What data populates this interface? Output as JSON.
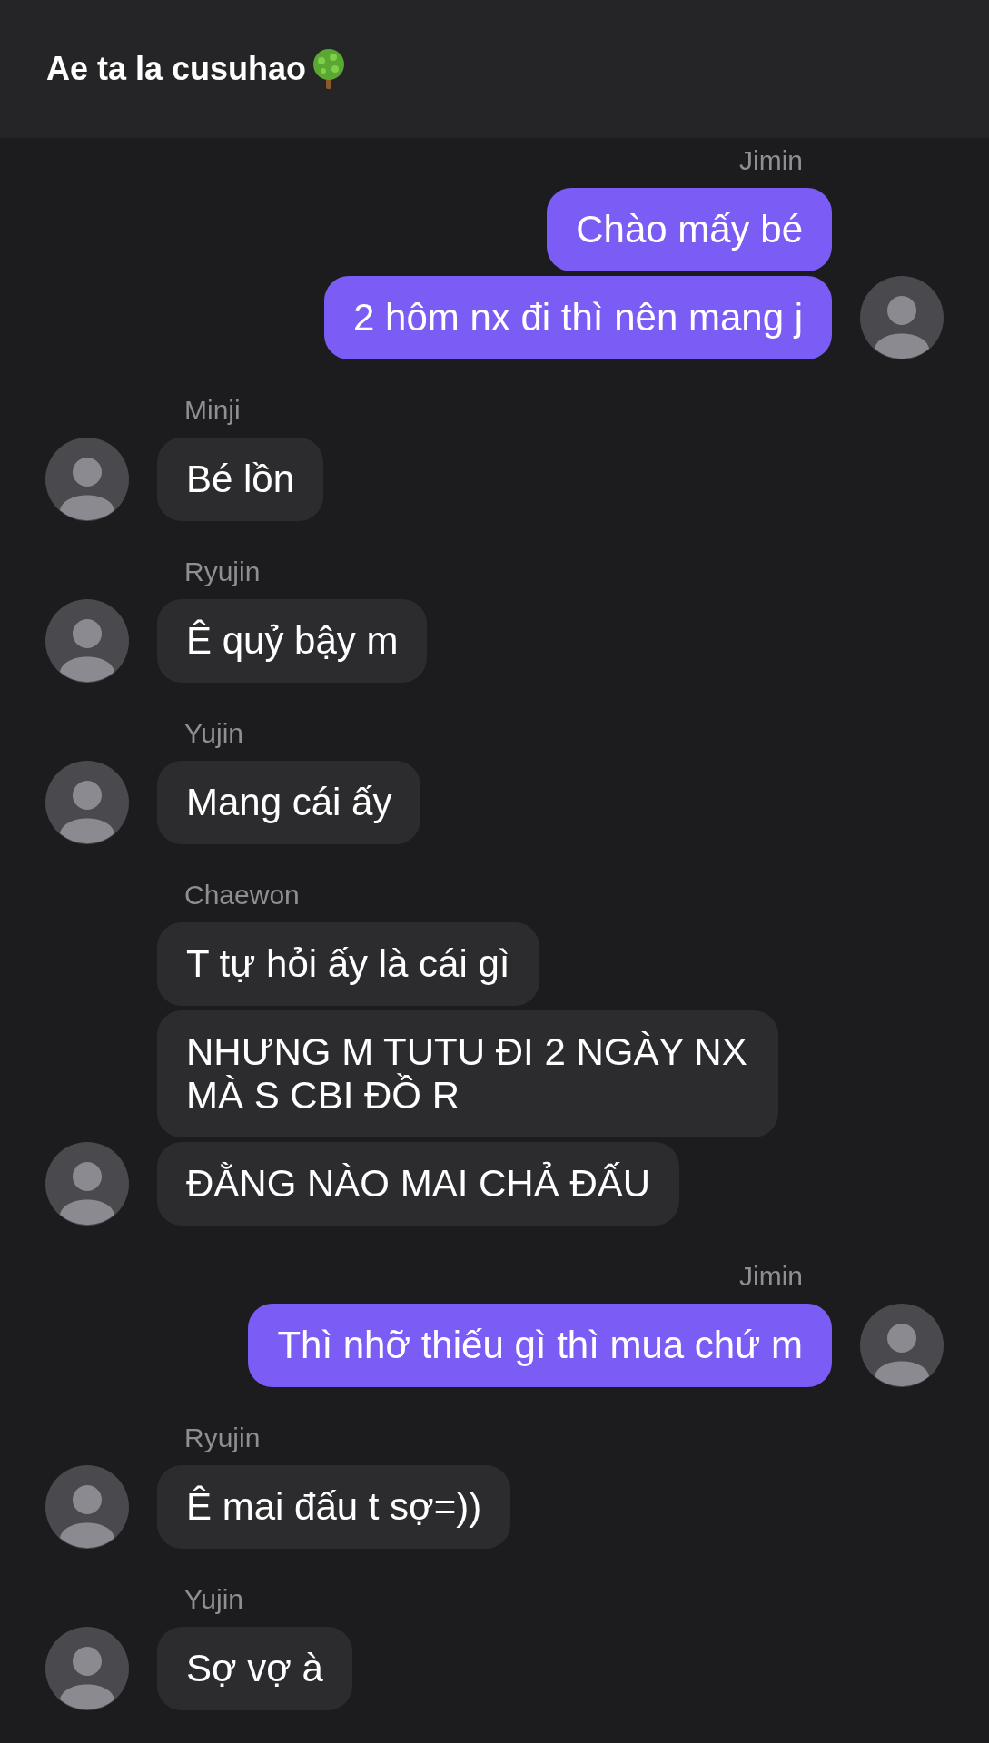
{
  "header": {
    "title": "Ae ta la cusuhao"
  },
  "messages": [
    {
      "kind": "outgoing",
      "sender": "Jimin",
      "text": "Chào mấy bé",
      "avatar": false
    },
    {
      "kind": "outgoing",
      "text": "2 hôm nx đi thì nên mang j",
      "avatar": true
    },
    {
      "kind": "incoming",
      "sender": "Minji",
      "text": "Bé lồn",
      "avatar": true
    },
    {
      "kind": "incoming",
      "sender": "Ryujin",
      "text": "Ê quỷ bậy m",
      "avatar": true
    },
    {
      "kind": "incoming",
      "sender": "Yujin",
      "text": "Mang cái ấy",
      "avatar": true
    },
    {
      "kind": "incoming",
      "sender": "Chaewon",
      "text": "T tự hỏi ấy là cái gì",
      "avatar": false
    },
    {
      "kind": "incoming",
      "text": "NHƯNG M TUTU ĐI 2 NGÀY NX MÀ S CBI ĐỒ R",
      "avatar": false
    },
    {
      "kind": "incoming",
      "text": "ĐẰNG NÀO MAI CHẢ ĐẤU",
      "avatar": true
    },
    {
      "kind": "outgoing",
      "sender": "Jimin",
      "text": "Thì nhỡ thiếu gì thì mua chứ m",
      "avatar": true
    },
    {
      "kind": "incoming",
      "sender": "Ryujin",
      "text": "Ê mai đấu t sợ=))",
      "avatar": true
    },
    {
      "kind": "incoming",
      "sender": "Yujin",
      "text": "Sợ vợ à",
      "avatar": true
    }
  ]
}
